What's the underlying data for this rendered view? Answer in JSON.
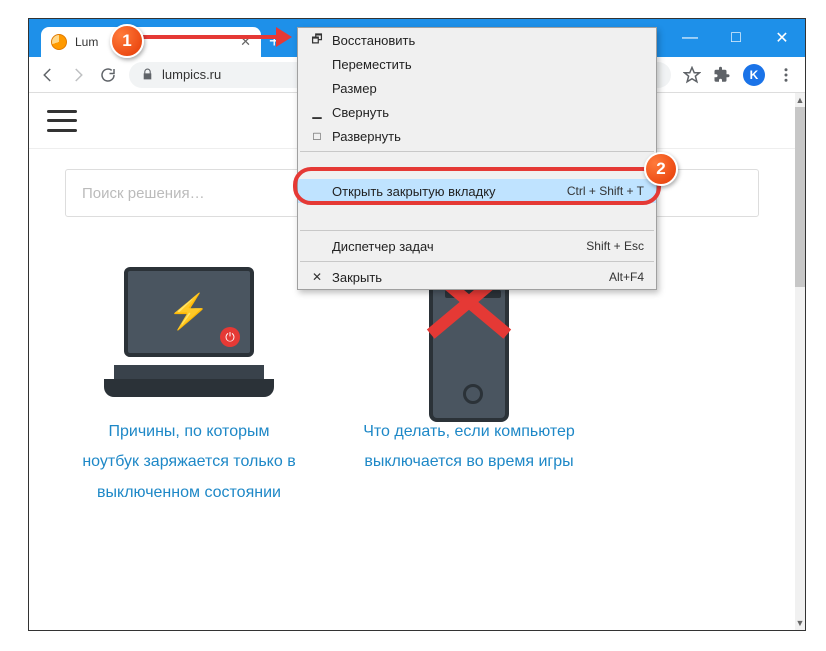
{
  "titlebar": {
    "tab_title": "Lum",
    "new_tab_glyph": "+"
  },
  "win": {
    "min": "—",
    "max": "□",
    "close": "✕"
  },
  "addr": {
    "url": "lumpics.ru",
    "avatar_letter": "K"
  },
  "site": {
    "search_placeholder": "Поиск решения…",
    "card1": "Причины, по которым ноутбук заряжается только в выключенном состоянии",
    "card2": "Что делать, если компьютер выключается во время игры"
  },
  "menu": {
    "restore": "Восстановить",
    "move": "Переместить",
    "size": "Размер",
    "minimize": "Свернуть",
    "maximize": "Развернуть",
    "hidden_top_label": "",
    "hidden_top_shortcut": "",
    "reopen": "Открыть закрытую вкладку",
    "reopen_shortcut": "Ctrl + Shift + T",
    "hidden_bot_label": "",
    "hidden_bot_shortcut": "",
    "taskmgr": "Диспетчер задач",
    "taskmgr_shortcut": "Shift + Esc",
    "close": "Закрыть",
    "close_shortcut": "Alt+F4"
  },
  "badges": {
    "one": "1",
    "two": "2"
  }
}
